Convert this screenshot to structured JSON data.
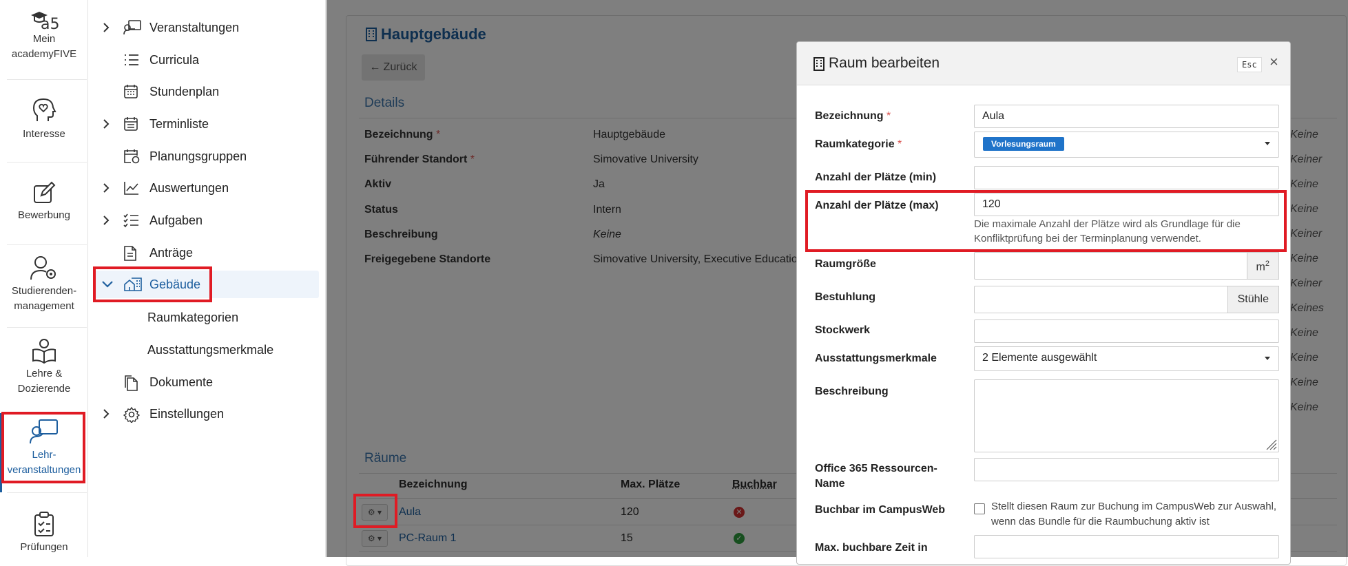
{
  "rail": {
    "items": [
      {
        "label": "Mein academyFIVE",
        "icon": "academyfive-logo"
      },
      {
        "label": "Interesse",
        "icon": "head-heart-icon"
      },
      {
        "label": "Bewerbung",
        "icon": "edit-icon"
      },
      {
        "label": "Studierenden-management",
        "icon": "user-gear-icon"
      },
      {
        "label": "Lehre & Dozierende",
        "icon": "book-user-icon"
      },
      {
        "label": "Lehr-veranstaltungen",
        "icon": "presenter-icon"
      },
      {
        "label": "Prüfungen",
        "icon": "clipboard-check-icon"
      }
    ]
  },
  "nav": {
    "items": [
      {
        "label": "Veranstaltungen",
        "icon": "presenter-icon",
        "expandable": true
      },
      {
        "label": "Curricula",
        "icon": "list-icon",
        "expandable": false
      },
      {
        "label": "Stundenplan",
        "icon": "calendar-grid-icon",
        "expandable": false
      },
      {
        "label": "Terminliste",
        "icon": "calendar-list-icon",
        "expandable": true
      },
      {
        "label": "Planungsgruppen",
        "icon": "calendar-user-icon",
        "expandable": false
      },
      {
        "label": "Auswertungen",
        "icon": "chart-line-icon",
        "expandable": true
      },
      {
        "label": "Aufgaben",
        "icon": "checklist-icon",
        "expandable": true
      },
      {
        "label": "Anträge",
        "icon": "document-icon",
        "expandable": false
      },
      {
        "label": "Gebäude",
        "icon": "building-icon",
        "expandable": true,
        "expanded": true,
        "active": true
      },
      {
        "label": "Dokumente",
        "icon": "documents-icon",
        "expandable": false
      },
      {
        "label": "Einstellungen",
        "icon": "gear-icon",
        "expandable": true
      }
    ],
    "subitems": [
      "Raumkategorien",
      "Ausstattungsmerkmale"
    ]
  },
  "page": {
    "title": "Hauptgebäude",
    "back": "Zurück",
    "details_heading": "Details",
    "details": [
      {
        "label": "Bezeichnung",
        "required": "*",
        "value": "Hauptgebäude"
      },
      {
        "label": "Führender Standort",
        "required": "*",
        "value": "Simovative University"
      },
      {
        "label": "Aktiv",
        "required": "",
        "value": "Ja"
      },
      {
        "label": "Status",
        "required": "",
        "value": "Intern"
      },
      {
        "label": "Beschreibung",
        "required": "",
        "value": "Keine"
      },
      {
        "label": "Freigegebene Standorte",
        "required": "",
        "value": "Simovative University, Executive Education"
      }
    ],
    "right_column": [
      "Keine",
      "Keiner",
      "Keine",
      "Keine",
      "Keiner",
      "Keine",
      "Keiner",
      "Keines",
      "Keine",
      "Keine",
      "Keine",
      "Keine"
    ],
    "rooms_heading": "Räume",
    "rooms_columns": [
      "Bezeichnung",
      "Max. Plätze",
      "Buchbar"
    ],
    "rooms": [
      {
        "name": "Aula",
        "max": "120",
        "bookable": false
      },
      {
        "name": "PC-Raum 1",
        "max": "15",
        "bookable": true
      }
    ]
  },
  "modal": {
    "title": "Raum bearbeiten",
    "esc": "Esc",
    "close": "×",
    "fields": {
      "bezeichnung": {
        "label": "Bezeichnung",
        "required": "*",
        "value": "Aula"
      },
      "raumkategorie": {
        "label": "Raumkategorie",
        "required": "*",
        "value": "Vorlesungsraum"
      },
      "plaetze_min": {
        "label": "Anzahl der Plätze (min)",
        "value": ""
      },
      "plaetze_max": {
        "label": "Anzahl der Plätze (max)",
        "value": "120",
        "help": "Die maximale Anzahl der Plätze wird als Grundlage für die Konfliktprüfung bei der Terminplanung verwendet."
      },
      "raumgroesse": {
        "label": "Raumgröße",
        "value": "",
        "addon": "m",
        "addon_sup": "2"
      },
      "bestuhlung": {
        "label": "Bestuhlung",
        "value": "",
        "addon": "Stühle"
      },
      "stockwerk": {
        "label": "Stockwerk",
        "value": ""
      },
      "ausstattung": {
        "label": "Ausstattungsmerkmale",
        "value": "2 Elemente ausgewählt"
      },
      "beschreibung": {
        "label": "Beschreibung",
        "value": ""
      },
      "o365": {
        "label": "Office 365 Ressourcen-Name",
        "value": ""
      },
      "buchbar": {
        "label": "Buchbar im CampusWeb",
        "text": "Stellt diesen Raum zur Buchung im CampusWeb zur Auswahl, wenn das Bundle für die Raumbuchung aktiv ist",
        "checked": false
      },
      "max_buchbar": {
        "label": "Max. buchbare Zeit in",
        "value": ""
      }
    }
  },
  "colors": {
    "accent": "#1d5e9e",
    "required": "#d9534f",
    "highlight": "#e01b24",
    "badge": "#1f73c9"
  }
}
